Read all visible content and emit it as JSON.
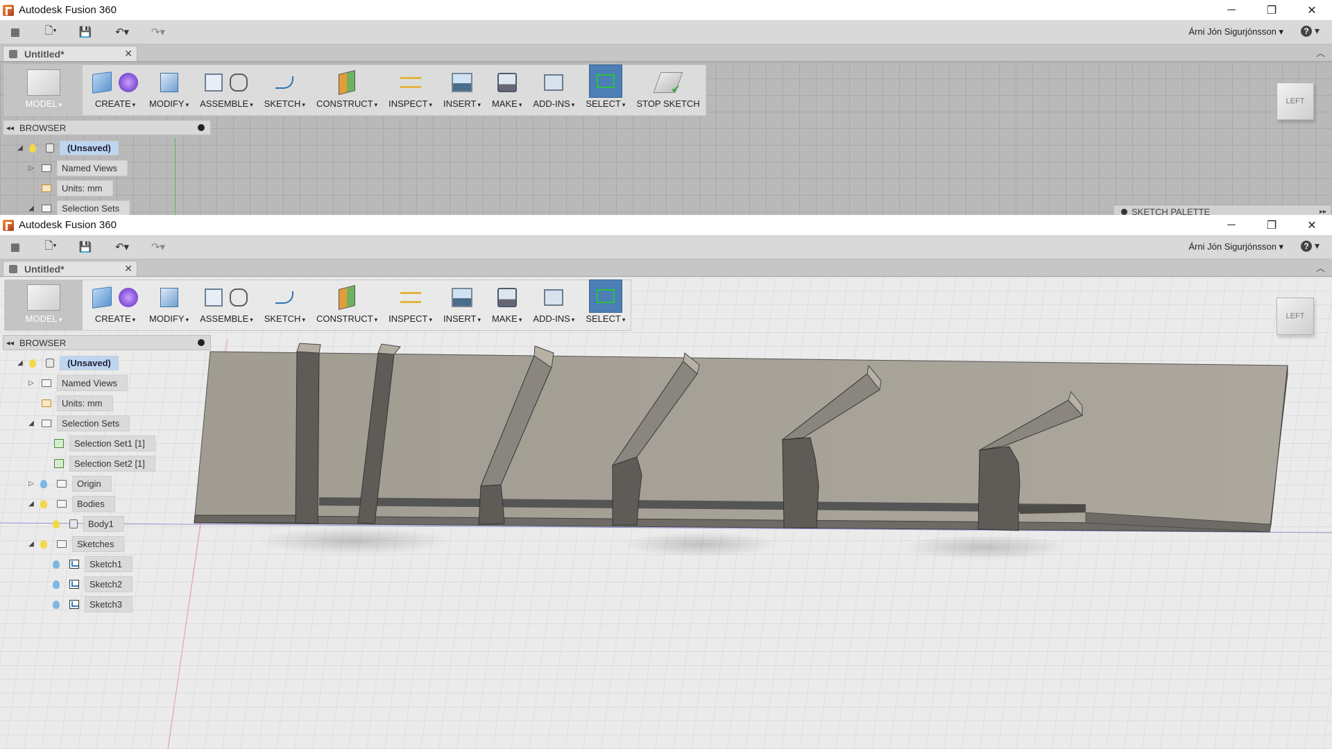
{
  "app": {
    "title": "Autodesk Fusion 360",
    "window_controls": {
      "minimize": "─",
      "maximize": "❐",
      "close": "✕"
    }
  },
  "quick_access": {
    "grid_icon": "grid-icon",
    "file_icon": "file-icon",
    "save_icon": "save-icon",
    "undo_icon": "undo-icon",
    "redo_icon": "redo-icon",
    "user_name": "Árni Jón Sigurjónsson ▾",
    "help_symbol": "?",
    "help_caret": "▾"
  },
  "document_tab": {
    "title": "Untitled*",
    "close": "✕",
    "collapse": "︿"
  },
  "toolbar": {
    "mode": "MODEL",
    "create": "CREATE",
    "modify": "MODIFY",
    "assemble": "ASSEMBLE",
    "sketch": "SKETCH",
    "construct": "CONSTRUCT",
    "inspect": "INSPECT",
    "insert": "INSERT",
    "make": "MAKE",
    "addins": "ADD-INS",
    "select": "SELECT",
    "stop_sketch": "STOP SKETCH",
    "caret": "▾"
  },
  "browser": {
    "title": "BROWSER",
    "collapse_arrow": "◂◂",
    "root": "(Unsaved)",
    "named_views": "Named Views",
    "units": "Units: mm",
    "selection_sets": "Selection Sets",
    "selection_set1": "Selection Set1 [1]",
    "selection_set2": "Selection Set2 [1]",
    "origin": "Origin",
    "bodies": "Bodies",
    "body1": "Body1",
    "sketches": "Sketches",
    "sketch1": "Sketch1",
    "sketch2": "Sketch2",
    "sketch3": "Sketch3",
    "expanded": "◢",
    "collapsed": "▷"
  },
  "viewcube": {
    "face": "LEFT"
  },
  "sketch_palette": {
    "title": "SKETCH PALETTE",
    "end": "▸▸"
  },
  "colors": {
    "accent_select": "#4b7fb6",
    "selected_node": "#bcd6f2",
    "model_face": "#a6a196",
    "model_top": "#b0aa9f",
    "model_side": "#6e6b66"
  }
}
